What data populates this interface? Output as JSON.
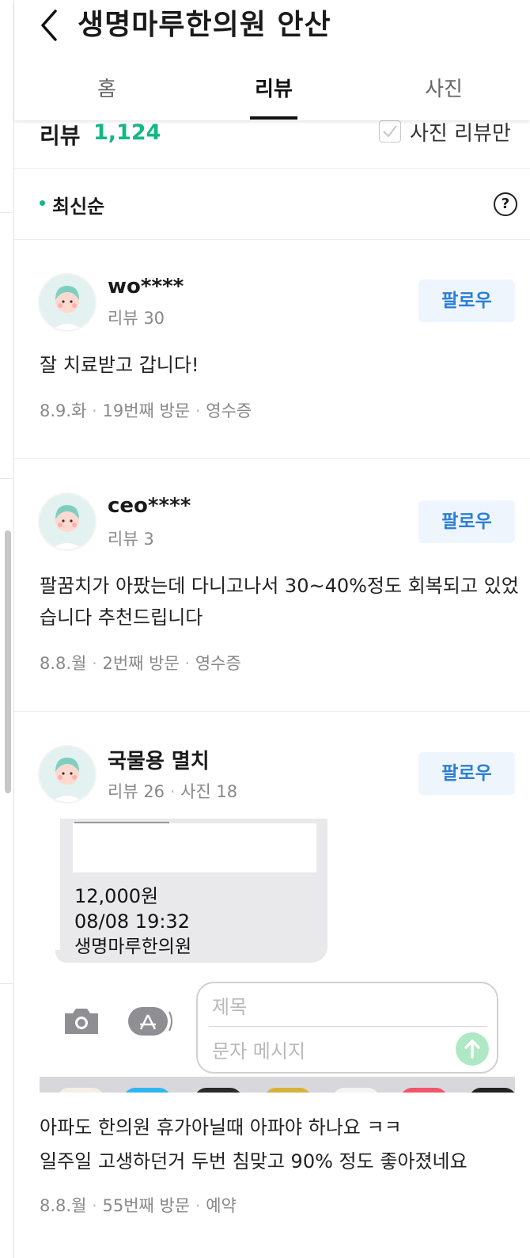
{
  "header": {
    "title": "생명마루한의원 안산",
    "tabs": [
      {
        "label": "홈",
        "active": false
      },
      {
        "label": "리뷰",
        "active": true
      },
      {
        "label": "사진",
        "active": false
      }
    ]
  },
  "summary": {
    "label": "리뷰",
    "count": "1,124",
    "photo_filter_label": "사진 리뷰만"
  },
  "sort": {
    "label": "최신순",
    "help_symbol": "?"
  },
  "colors": {
    "accent": "#12b886",
    "follow_text": "#2a7fd4",
    "follow_bg": "#eff5fd"
  },
  "reviews": [
    {
      "user": "wo****",
      "stats": "리뷰 30",
      "follow_label": "팔로우",
      "text": "잘 치료받고 갑니다!",
      "date": "8.9.화",
      "visit": "19번째 방문",
      "verify": "영수증"
    },
    {
      "user": "ceo****",
      "stats": "리뷰 3",
      "follow_label": "팔로우",
      "text": "팔꿈치가 아팠는데 다니고나서 30~40%정도 회복되고 있었습니다 추천드립니다",
      "date": "8.8.월",
      "visit": "2번째 방문",
      "verify": "영수증"
    },
    {
      "user": "국물용 멸치",
      "stats_reviews": "리뷰 26",
      "stats_photos": "사진 18",
      "follow_label": "팔로우",
      "photo": {
        "amount": "12,000원",
        "datetime": "08/08 19:32",
        "clinic": "생명마루한의원",
        "subject_placeholder": "제목",
        "message_placeholder": "문자 메시지"
      },
      "text_line1": "아파도 한의원 휴가아닐때 아파야 하나요 ㅋㅋ",
      "text_line2": "일주일 고생하던거 두번 침맞고 90% 정도 좋아졌네요",
      "date": "8.8.월",
      "visit": "55번째 방문",
      "verify": "예약"
    }
  ]
}
